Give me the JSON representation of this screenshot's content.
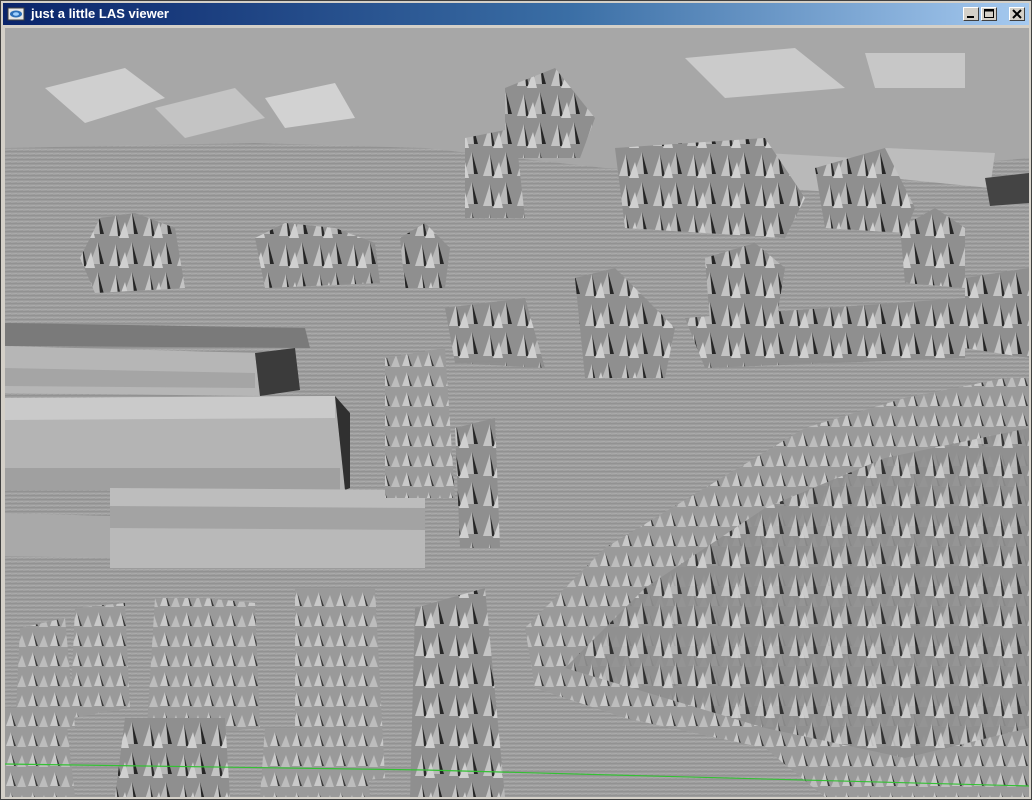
{
  "window": {
    "title": "just a little LAS viewer",
    "controls": [
      "minimize",
      "maximize",
      "close"
    ],
    "icon": "app-icon"
  },
  "viewport": {
    "content": "lidar-point-cloud-render",
    "palette": {
      "ground": "#9d9d9d",
      "light": "#c8c8c8",
      "mid": "#8a8a8a",
      "dark": "#2e2e2e",
      "axis": "#34c034"
    }
  }
}
